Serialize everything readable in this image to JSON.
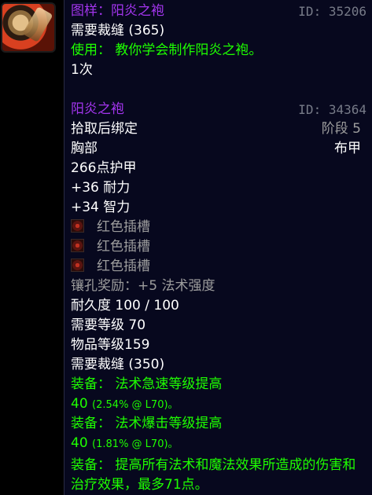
{
  "recipe": {
    "title": "图样：阳炎之袍",
    "id": "ID: 35206",
    "requires": "需要裁缝 (365)",
    "use": "使用： 教你学会制作阳炎之袍。",
    "count": "1次"
  },
  "item": {
    "name": "阳炎之袍",
    "id": "ID: 34364",
    "bind": "拾取后绑定",
    "tier": "阶段 5",
    "slot": "胸部",
    "type": "布甲",
    "armor": "266点护甲",
    "stat1": "+36 耐力",
    "stat2": "+34 智力",
    "sockets": [
      "红色插槽",
      "红色插槽",
      "红色插槽"
    ],
    "socket_bonus": "镶孔奖励：+5 法术强度",
    "durability": "耐久度 100 / 100",
    "req_level": "需要等级 70",
    "item_level": "物品等级159",
    "req_skill": "需要裁缝 (350)",
    "equip1_label": "装备： 法术急速等级提高",
    "equip1_value": "40",
    "equip1_detail": "(2.54% @ L70)。",
    "equip2_label": "装备： 法术爆击等级提高",
    "equip2_value": "40",
    "equip2_detail": "(1.81% @ L70)。",
    "equip3": "装备： 提高所有法术和魔法效果所造成的伤害和治疗效果，最多71点。"
  },
  "colors": {
    "epic": "#a335ee",
    "green": "#1eff00",
    "gray": "#9d9d9d",
    "background": "#07081e"
  },
  "icons": {
    "item_icon": "recipe-scroll-icon",
    "socket_icon": "red-socket-icon"
  }
}
